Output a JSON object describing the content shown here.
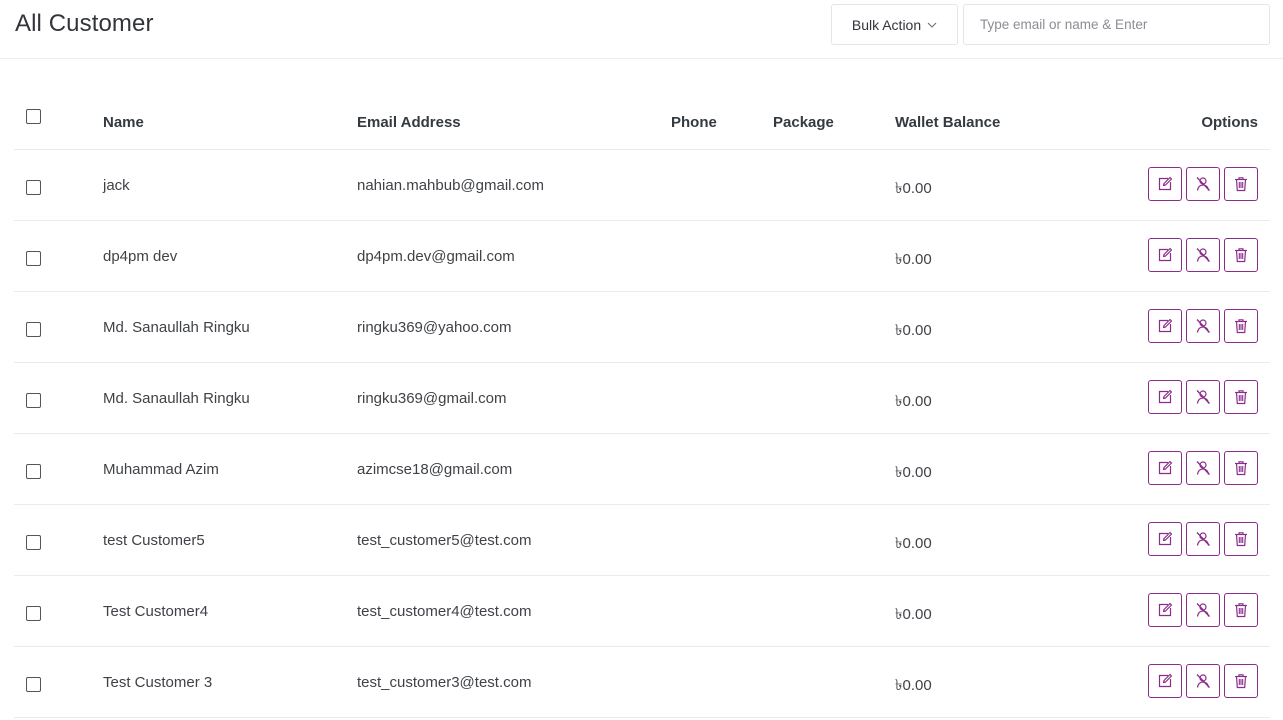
{
  "page": {
    "title": "All Customer"
  },
  "toolbar": {
    "bulk_action_label": "Bulk Action",
    "search_placeholder": "Type email or name & Enter",
    "search_value": ""
  },
  "table": {
    "columns": [
      "Name",
      "Email Address",
      "Phone",
      "Package",
      "Wallet Balance",
      "Options"
    ],
    "rows": [
      {
        "name": "jack",
        "email": "nahian.mahbub@gmail.com",
        "phone": "",
        "package": "",
        "wallet": "৳0.00"
      },
      {
        "name": "dp4pm dev",
        "email": "dp4pm.dev@gmail.com",
        "phone": "",
        "package": "",
        "wallet": "৳0.00"
      },
      {
        "name": "Md. Sanaullah Ringku",
        "email": "ringku369@yahoo.com",
        "phone": "",
        "package": "",
        "wallet": "৳0.00"
      },
      {
        "name": "Md. Sanaullah Ringku",
        "email": "ringku369@gmail.com",
        "phone": "",
        "package": "",
        "wallet": "৳0.00"
      },
      {
        "name": "Muhammad Azim",
        "email": "azimcse18@gmail.com",
        "phone": "",
        "package": "",
        "wallet": "৳0.00"
      },
      {
        "name": "test Customer5",
        "email": "test_customer5@test.com",
        "phone": "",
        "package": "",
        "wallet": "৳0.00"
      },
      {
        "name": "Test Customer4",
        "email": "test_customer4@test.com",
        "phone": "",
        "package": "",
        "wallet": "৳0.00"
      },
      {
        "name": "Test Customer 3",
        "email": "test_customer3@test.com",
        "phone": "",
        "package": "",
        "wallet": "৳0.00"
      }
    ]
  },
  "icons": {
    "bulk_caret": "chevron-down-icon",
    "edit": "edit-icon",
    "ban": "user-slash-icon",
    "delete": "trash-icon"
  },
  "colors": {
    "accent": "#8b2c8b",
    "border": "#e9ecef"
  }
}
